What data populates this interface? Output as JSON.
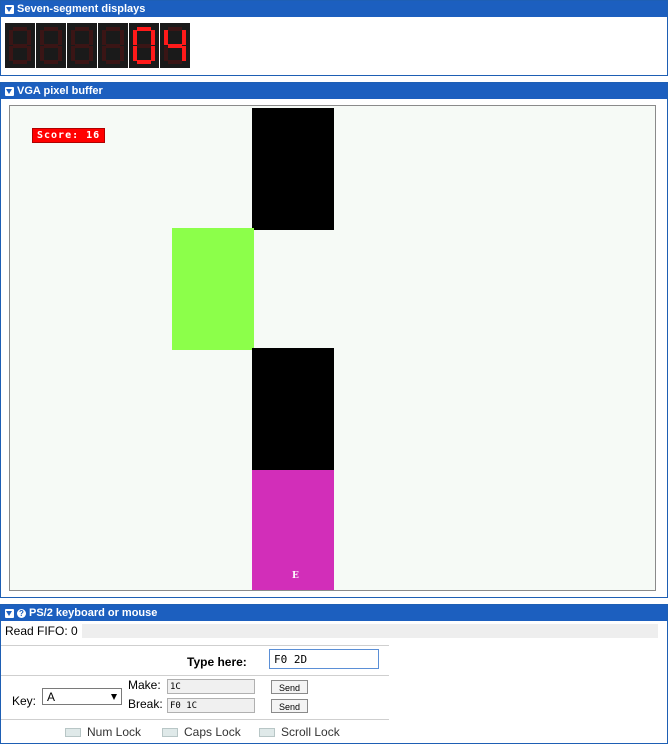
{
  "seven_segment": {
    "title": "Seven-segment displays",
    "digits": [
      {
        "segments": ""
      },
      {
        "segments": ""
      },
      {
        "segments": ""
      },
      {
        "segments": ""
      },
      {
        "segments": "abcdef"
      },
      {
        "segments": "bcfg"
      }
    ],
    "digit_values": [
      "",
      "",
      "",
      "",
      "0",
      "4"
    ]
  },
  "vga": {
    "title": "VGA pixel buffer",
    "score_text": "Score: 16",
    "blocks": [
      {
        "name": "black-block-top",
        "color": "#000000"
      },
      {
        "name": "green-block",
        "color": "#8cff4a"
      },
      {
        "name": "black-block-bottom",
        "color": "#000000"
      },
      {
        "name": "magenta-block",
        "color": "#d22eb9"
      }
    ],
    "lane_labels": [
      "",
      "E",
      "",
      ""
    ]
  },
  "ps2": {
    "title": "PS/2 keyboard or mouse",
    "read_fifo": "Read FIFO: 0",
    "type_here_label": "Type here:",
    "type_here_value": "F0 2D",
    "key_label": "Key:",
    "key_value": "A",
    "make_label": "Make:",
    "make_value": "1C",
    "break_label": "Break:",
    "break_value": "F0 1C",
    "send_label": "Send",
    "locks": {
      "num": "Num Lock",
      "caps": "Caps Lock",
      "scroll": "Scroll Lock"
    }
  },
  "colors": {
    "header_blue": "#1c5fbf",
    "segment_on": "#ff1a1a",
    "score_bg": "#ff0000"
  }
}
